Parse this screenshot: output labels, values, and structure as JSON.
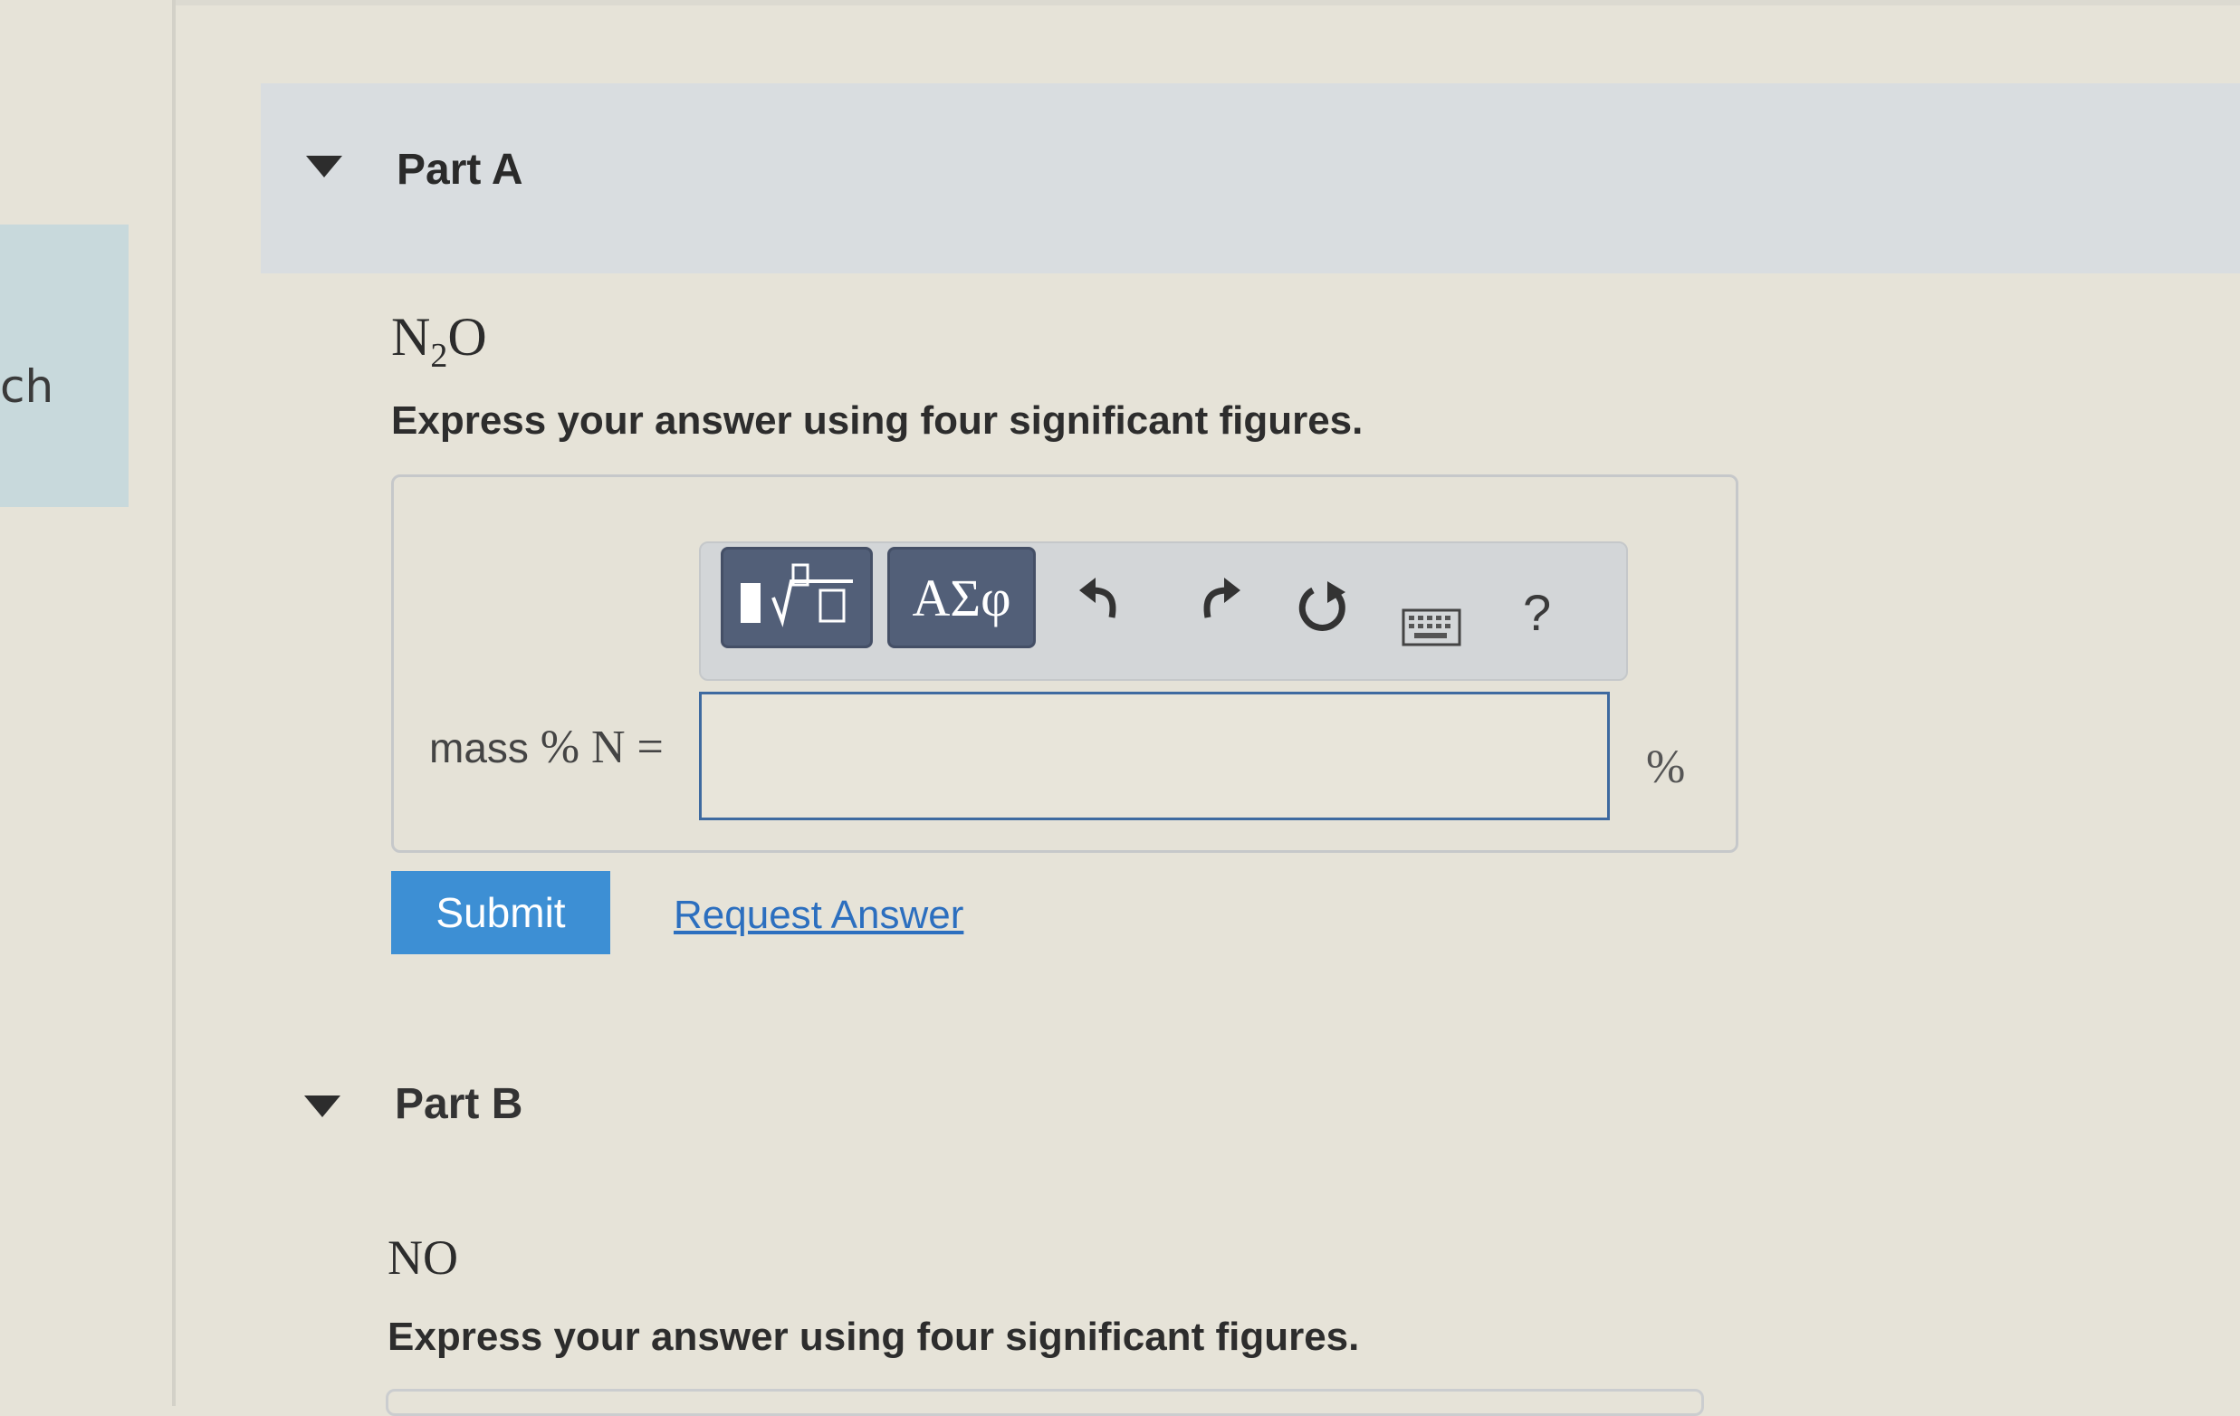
{
  "sidebar": {
    "tab_text": "ch"
  },
  "part_a": {
    "title": "Part A",
    "formula_main": "N",
    "formula_sub": "2",
    "formula_end": "O",
    "instruction": "Express your answer using four significant figures.",
    "toolbar": {
      "templates_icon": "fraction-sqrt-icon",
      "greek_label": "ΑΣφ",
      "undo_icon": "undo-icon",
      "redo_icon": "redo-icon",
      "reset_icon": "reset-icon",
      "keyboard_icon": "keyboard-icon",
      "help_label": "?"
    },
    "label_text": "mass ",
    "label_math": "% N =",
    "answer_value": "",
    "unit": "%",
    "submit_label": "Submit",
    "request_label": "Request Answer"
  },
  "part_b": {
    "title": "Part B",
    "formula": "NO",
    "instruction": "Express your answer using four significant figures."
  },
  "colors": {
    "submit_bg": "#3d8fd4",
    "link": "#2c6fbf",
    "toolbar_button": "#525f78",
    "input_border": "#3e6aa0"
  }
}
